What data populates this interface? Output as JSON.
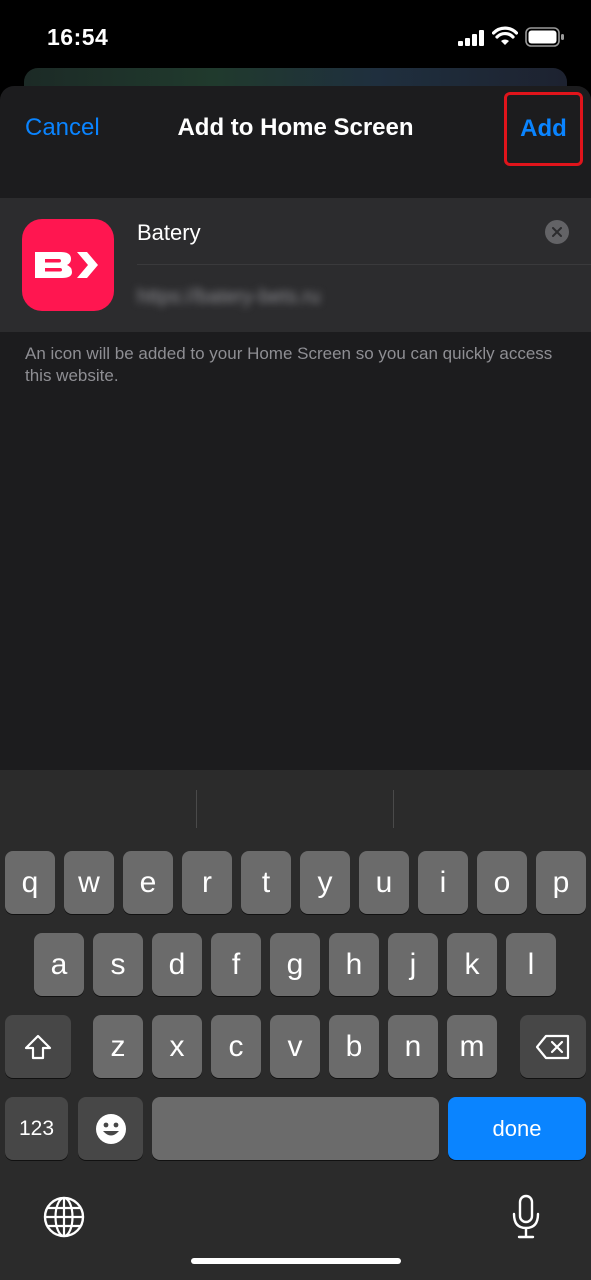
{
  "status_bar": {
    "time": "16:54"
  },
  "nav": {
    "cancel_label": "Cancel",
    "title": "Add to Home Screen",
    "add_label": "Add"
  },
  "app": {
    "name": "Batery",
    "url": "https://batery-bets.ru",
    "icon_color": "#ff1650"
  },
  "note": "An icon will be added to your Home Screen so you can quickly access this website.",
  "keyboard": {
    "row1": [
      "q",
      "w",
      "e",
      "r",
      "t",
      "y",
      "u",
      "i",
      "o",
      "p"
    ],
    "row2": [
      "a",
      "s",
      "d",
      "f",
      "g",
      "h",
      "j",
      "k",
      "l"
    ],
    "row3": [
      "z",
      "x",
      "c",
      "v",
      "b",
      "n",
      "m"
    ],
    "numbers_label": "123",
    "done_label": "done"
  },
  "colors": {
    "accent": "#0a84ff",
    "highlight": "#e0141b"
  }
}
